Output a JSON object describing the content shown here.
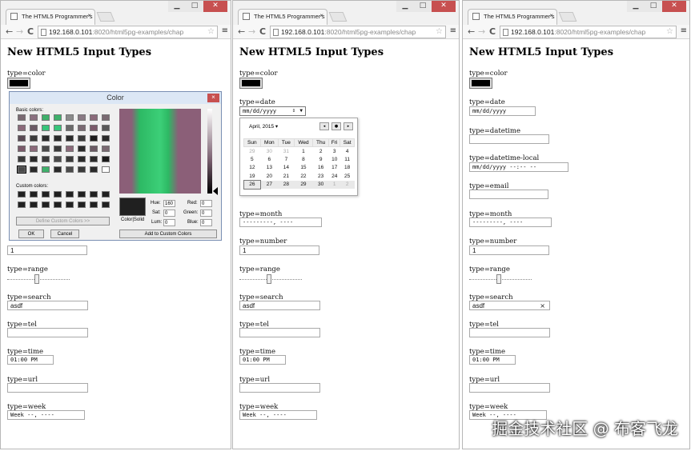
{
  "browser": {
    "tab_title": "The HTML5 Programmer's",
    "url_host": "192.168.0.101",
    "url_rest": ":8020/html5pg-examples/chap",
    "win_min": "▁",
    "win_max": "□",
    "win_close": "✕",
    "back": "←",
    "forward": "→",
    "reload": "C",
    "star": "☆",
    "menu": "≡",
    "tab_close": "×"
  },
  "page": {
    "title": "New HTML5 Input Types",
    "labels": {
      "color": "type=color",
      "date": "type=date",
      "datetime": "type=datetime",
      "datetime_local": "type=datetime-local",
      "email": "type=email",
      "month": "type=month",
      "number": "type=number",
      "range": "type=range",
      "search": "type=search",
      "tel": "type=tel",
      "time": "type=time",
      "url": "type=url",
      "week": "type=week"
    },
    "values": {
      "date": "mm/dd/yyyy",
      "month": "---------, ----",
      "number": "1",
      "range_pct": 0.47,
      "search": "asdf",
      "time": "01:00 PM",
      "week": "Week --, ----",
      "datetime_local": "mm/dd/yyyy --:-- --",
      "search_clear": "×",
      "spin": "⇕",
      "drop": "▼"
    }
  },
  "color_dialog": {
    "title": "Color",
    "close": "×",
    "basic_colors": "Basic colors:",
    "custom_colors": "Custom colors:",
    "define_custom": "Define Custom Colors >>",
    "ok": "OK",
    "cancel": "Cancel",
    "add_custom": "Add to Custom Colors",
    "color_solid": "Color|Solid",
    "hue_label": "Hue:",
    "hue": "160",
    "sat_label": "Sat:",
    "sat": "0",
    "lum_label": "Lum:",
    "lum": "0",
    "red_label": "Red:",
    "red": "0",
    "green_label": "Green:",
    "green": "0",
    "blue_label": "Blue:",
    "blue": "0",
    "basic_swatches": [
      "#7a6a72",
      "#8b7080",
      "#3fb06b",
      "#3fb06b",
      "#8b8b8b",
      "#8a7a84",
      "#8b6a7a",
      "#7a6a72",
      "#8b6a7a",
      "#6a5a64",
      "#37c47a",
      "#37c47a",
      "#6a6a6a",
      "#7a6a72",
      "#7a5a6a",
      "#5a5a5a",
      "#5a4a54",
      "#3a3a3a",
      "#2a2a2a",
      "#2a2a2a",
      "#2a2a2a",
      "#3a3a3a",
      "#1a1a1a",
      "#2a2a2a",
      "#7a5a6a",
      "#8b6a7a",
      "#4a4a4a",
      "#3a3a3a",
      "#8b6a7a",
      "#2a2a2a",
      "#6a5a64",
      "#7a6a72",
      "#3a3a3a",
      "#2a2a2a",
      "#3a3a3a",
      "#4a4a4a",
      "#3a3a3a",
      "#2a2a2a",
      "#2a2a2a",
      "#1a1a1a",
      "#4a4a4a",
      "#2a2a2a",
      "#3fb06b",
      "#2a2a2a",
      "#4a4a4a",
      "#3a3a3a",
      "#2a2a2a",
      "#ffffff"
    ],
    "custom_swatch": "#202020"
  },
  "calendar": {
    "month": "April, 2015 ▾",
    "prev": "◂",
    "today": "●",
    "next": "▸",
    "days": [
      "Sun",
      "Mon",
      "Tue",
      "Wed",
      "Thu",
      "Fri",
      "Sat"
    ],
    "weeks": [
      [
        "29",
        "30",
        "31",
        "1",
        "2",
        "3",
        "4"
      ],
      [
        "5",
        "6",
        "7",
        "8",
        "9",
        "10",
        "11"
      ],
      [
        "12",
        "13",
        "14",
        "15",
        "16",
        "17",
        "18"
      ],
      [
        "19",
        "20",
        "21",
        "22",
        "23",
        "24",
        "25"
      ],
      [
        "26",
        "27",
        "28",
        "29",
        "30",
        "1",
        "2"
      ]
    ]
  },
  "watermark": "掘金技术社区 @ 布客飞龙"
}
